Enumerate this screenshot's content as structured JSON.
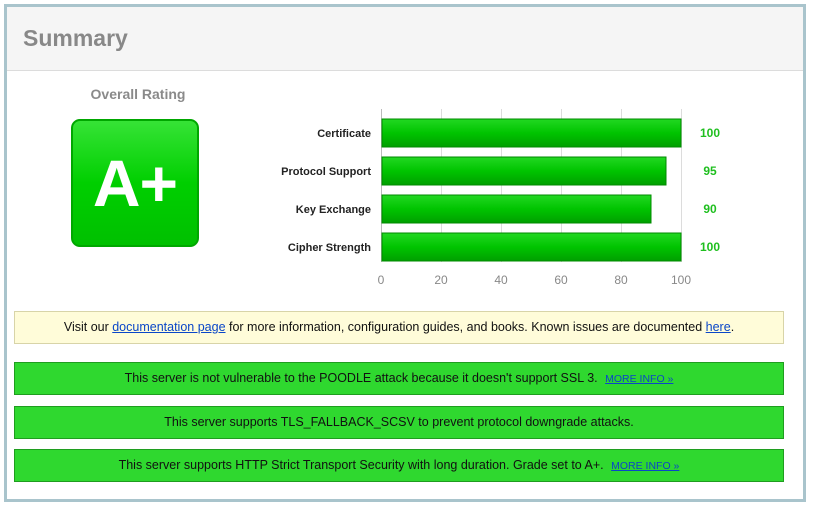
{
  "header": {
    "title": "Summary"
  },
  "rating": {
    "label": "Overall Rating",
    "grade": "A+"
  },
  "chart_data": {
    "type": "bar",
    "orientation": "horizontal",
    "categories": [
      "Certificate",
      "Protocol Support",
      "Key Exchange",
      "Cipher Strength"
    ],
    "values": [
      100,
      95,
      90,
      100
    ],
    "value_labels": [
      "100",
      "95",
      "90",
      "100"
    ],
    "xlim": [
      0,
      100
    ],
    "xticks": [
      0,
      20,
      40,
      60,
      80,
      100
    ],
    "grid": true,
    "legend": "none",
    "bar_color": "#00b800",
    "value_label_color": "#1fbf1f"
  },
  "notices": {
    "doc": {
      "prefix": "Visit our ",
      "link": "documentation page",
      "middle": " for more information, configuration guides, and books. Known issues are documented ",
      "link2": "here",
      "suffix": "."
    },
    "poodle": {
      "text": "This server is not vulnerable to the POODLE attack because it doesn't support SSL 3.",
      "more": "MORE INFO »"
    },
    "fallback": {
      "text": "This server supports TLS_FALLBACK_SCSV to prevent protocol downgrade attacks."
    },
    "hsts": {
      "text": "This server supports HTTP Strict Transport Security with long duration. Grade set to A+.",
      "more": "MORE INFO »"
    }
  },
  "colors": {
    "grade_green": "#00cf00",
    "notice_green": "#2fd82f",
    "notice_yellow": "#fffcd9",
    "link_blue": "#0a46c8"
  }
}
